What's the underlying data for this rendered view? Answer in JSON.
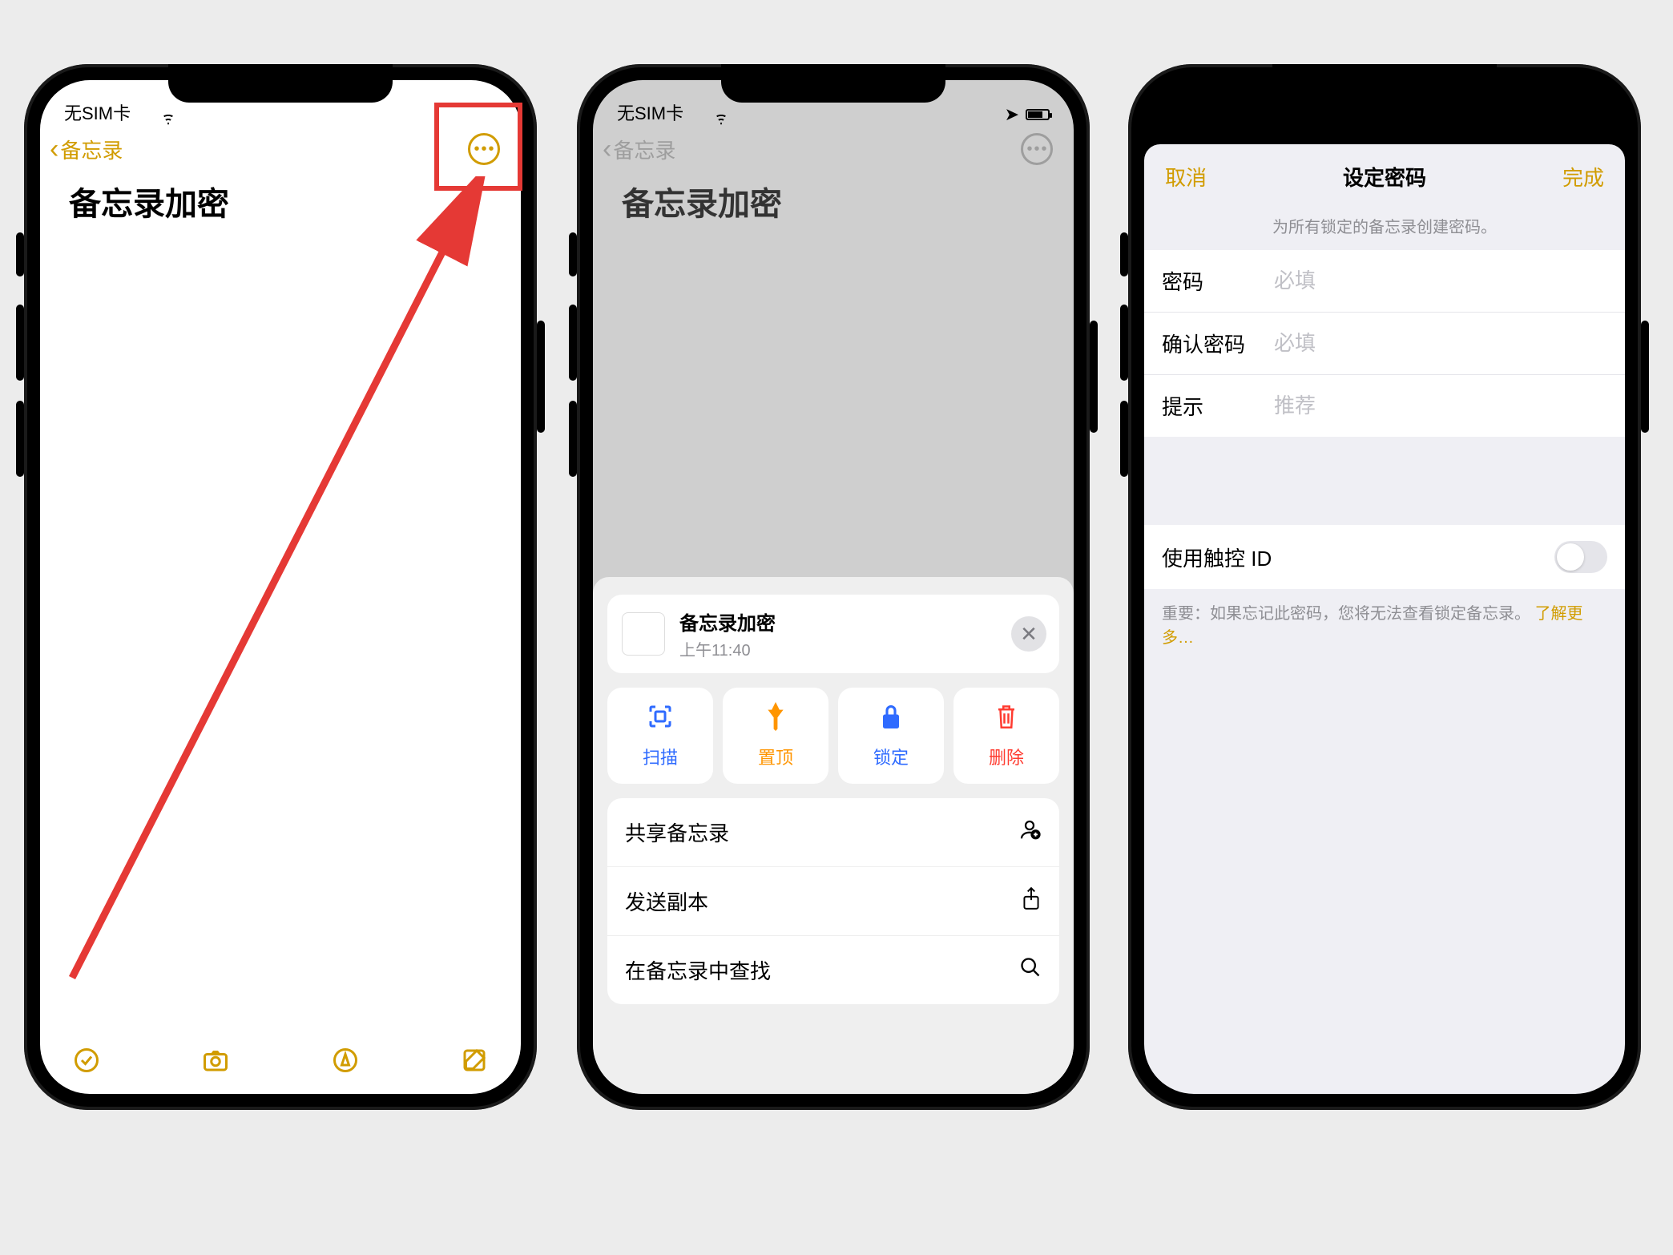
{
  "statusbar": {
    "carrier": "无SIM卡"
  },
  "phone1": {
    "nav": {
      "back": "备忘录"
    },
    "note_title": "备忘录加密"
  },
  "phone2": {
    "nav": {
      "back": "备忘录"
    },
    "note_title": "备忘录加密",
    "sheet": {
      "title": "备忘录加密",
      "time": "上午11:40",
      "actions": {
        "scan": "扫描",
        "pin": "置顶",
        "lock": "锁定",
        "delete": "删除"
      },
      "list": {
        "share": "共享备忘录",
        "send_copy": "发送副本",
        "find": "在备忘录中查找"
      }
    }
  },
  "phone3": {
    "nav": {
      "cancel": "取消",
      "title": "设定密码",
      "done": "完成"
    },
    "hint": "为所有锁定的备忘录创建密码。",
    "fields": {
      "password_label": "密码",
      "password_placeholder": "必填",
      "confirm_label": "确认密码",
      "confirm_placeholder": "必填",
      "hint_label": "提示",
      "hint_placeholder": "推荐"
    },
    "touchid_label": "使用触控 ID",
    "footer_prefix": "重要：如果忘记此密码，您将无法查看锁定备忘录。",
    "footer_link": "了解更多…"
  }
}
